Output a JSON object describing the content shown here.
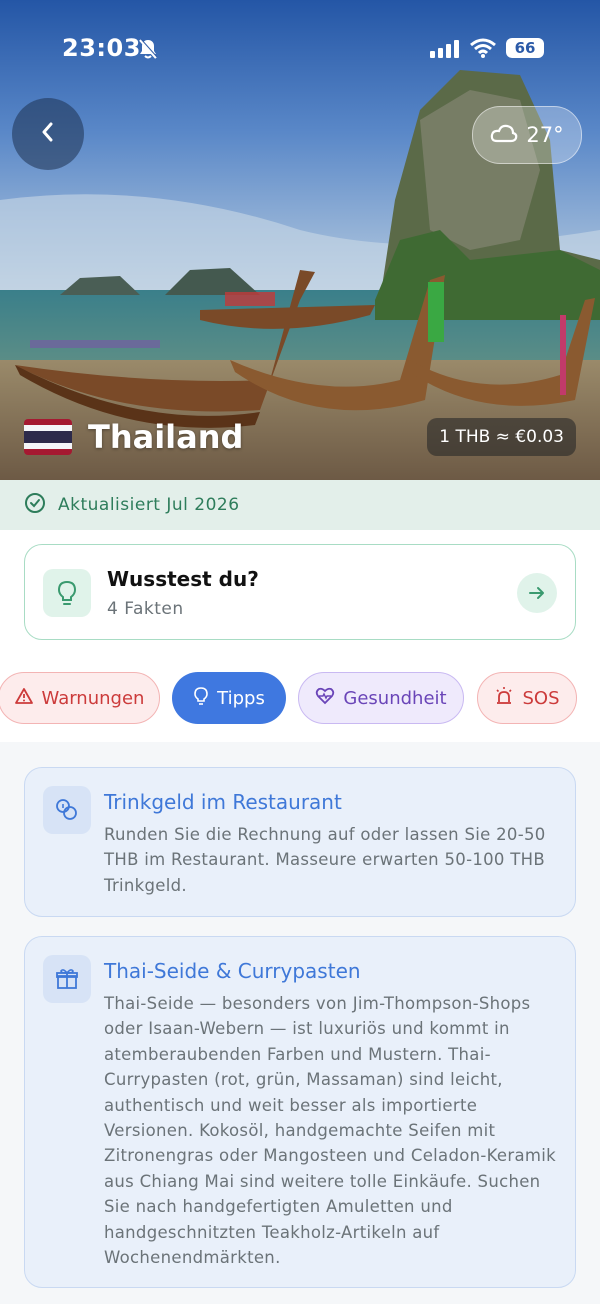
{
  "status_bar": {
    "time": "23:03",
    "battery": "66"
  },
  "hero": {
    "weather": {
      "temperature": "27°",
      "icon": "cloud-icon"
    },
    "country": {
      "name": "Thailand",
      "flag": "thailand-flag"
    },
    "exchange_rate": "1 THB ≈ €0.03"
  },
  "updated": {
    "text": "Aktualisiert Jul 2026",
    "icon": "check-circle-icon"
  },
  "facts_card": {
    "title": "Wusstest du?",
    "subtitle": "4 Fakten",
    "icon": "lightbulb-icon"
  },
  "tabs": [
    {
      "label": "Warnungen",
      "icon": "warning-icon",
      "active": false
    },
    {
      "label": "Tipps",
      "icon": "lightbulb-icon",
      "active": true
    },
    {
      "label": "Gesundheit",
      "icon": "heart-pulse-icon",
      "active": false
    },
    {
      "label": "SOS",
      "icon": "siren-icon",
      "active": false
    }
  ],
  "tips": [
    {
      "title": "Trinkgeld im Restaurant",
      "icon": "coins-icon",
      "body": "Runden Sie die Rechnung auf oder lassen Sie 20-50 THB im Restaurant. Masseure erwarten 50-100 THB Trinkgeld."
    },
    {
      "title": "Thai-Seide & Currypasten",
      "icon": "gift-icon",
      "body": "Thai-Seide — besonders von Jim-Thompson-Shops oder Isaan-Webern — ist luxuriös und kommt in atemberaubenden Farben und Mustern. Thai-Currypasten (rot, grün, Massaman) sind leicht, authentisch und weit besser als importierte Versionen. Kokosöl, handgemachte Seifen mit Zitronengras oder Mangosteen und Celadon-Keramik aus Chiang Mai sind weitere tolle Einkäufe. Suchen Sie nach handgefertigten Amuletten und handgeschnitzten Teakholz-Artikeln auf Wochenendmärkten."
    }
  ],
  "colors": {
    "accent": "#3f78e0",
    "success": "#2e7d5b",
    "danger": "#cc3b3b",
    "health": "#6a45b8"
  }
}
